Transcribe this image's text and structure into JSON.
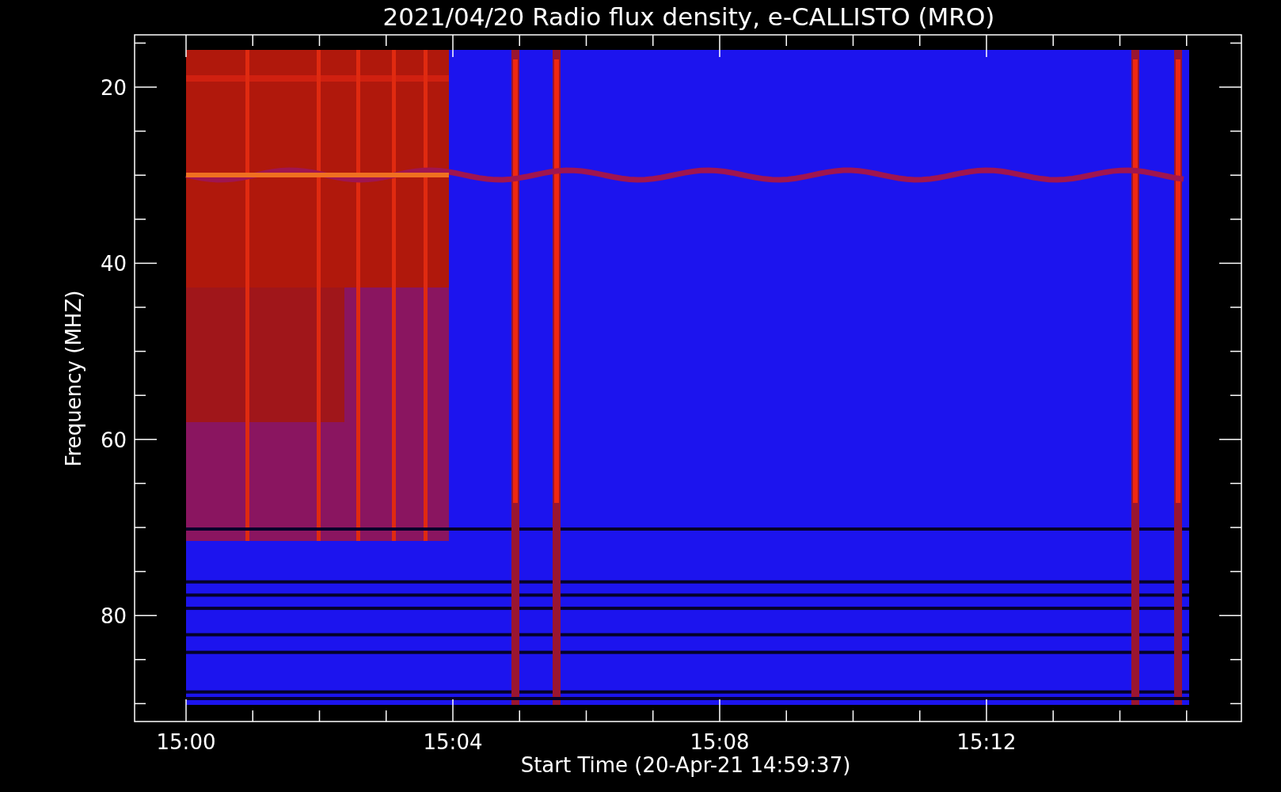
{
  "title": "2021/04/20  Radio flux density, e-CALLISTO (MRO)",
  "ylabel": "Frequency (MHZ)",
  "xlabel": "Start Time (20-Apr-21 14:59:37)",
  "yticks": [
    "20",
    "40",
    "60",
    "80"
  ],
  "xticks": [
    "15:00",
    "15:04",
    "15:08",
    "15:12"
  ]
}
